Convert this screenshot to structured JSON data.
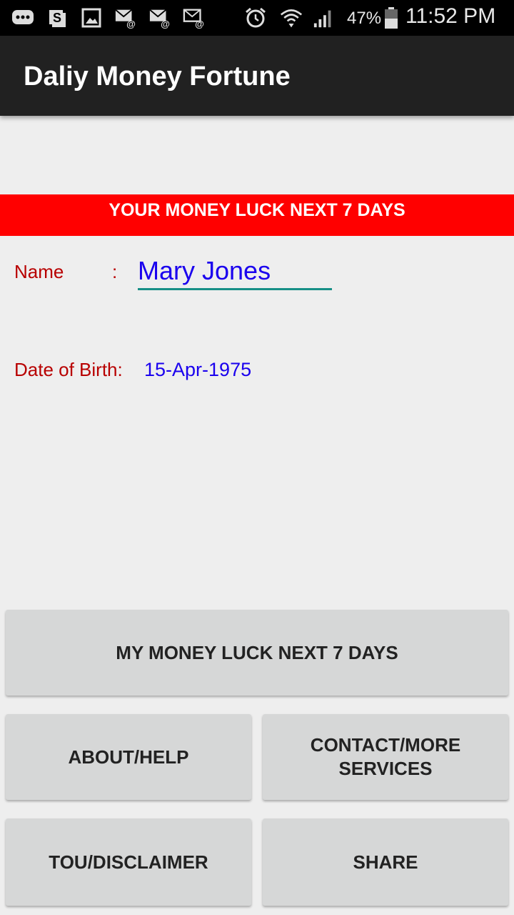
{
  "status_bar": {
    "battery_percent": "47%",
    "time": "11:52 PM",
    "icons": [
      "chat-bubble-icon",
      "s-box-icon",
      "image-icon",
      "email-at-icon",
      "email-at-icon",
      "email-at-icon",
      "alarm-icon",
      "wifi-icon",
      "signal-icon",
      "battery-icon"
    ]
  },
  "app_bar": {
    "title": "Daliy Money Fortune"
  },
  "banner": {
    "text": "YOUR MONEY LUCK NEXT 7 DAYS"
  },
  "form": {
    "name_label": "Name",
    "name_separator": ":",
    "name_value": "Mary Jones",
    "dob_label": "Date of Birth:",
    "dob_value": "15-Apr-1975"
  },
  "buttons": {
    "money_luck": "MY MONEY LUCK NEXT 7 DAYS",
    "about_help": "ABOUT/HELP",
    "contact_line1": "CONTACT/MORE",
    "contact_line2": "SERVICES",
    "tou": "TOU/DISCLAIMER",
    "share": "SHARE"
  },
  "colors": {
    "banner": "#ff0000",
    "app_bar": "#212121",
    "label_red": "#b80000",
    "value_blue": "#1a00ee",
    "input_underline": "#178f86"
  }
}
